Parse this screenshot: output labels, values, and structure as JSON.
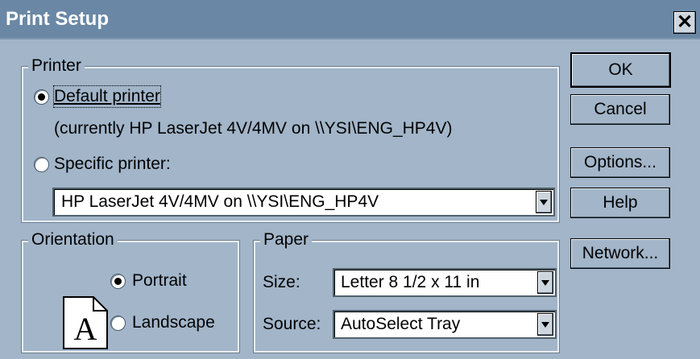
{
  "dialog": {
    "title": "Print Setup",
    "close_glyph": "✕"
  },
  "printer": {
    "legend": "Printer",
    "default_label": "Default printer",
    "default_selected": true,
    "current_info": "(currently HP LaserJet 4V/4MV on \\\\YSI\\ENG_HP4V)",
    "specific_label": "Specific printer:",
    "specific_selected": false,
    "specific_value": "HP LaserJet 4V/4MV on \\\\YSI\\ENG_HP4V"
  },
  "orientation": {
    "legend": "Orientation",
    "portrait_label": "Portrait",
    "portrait_selected": true,
    "landscape_label": "Landscape",
    "landscape_selected": false,
    "icon_letter": "A"
  },
  "paper": {
    "legend": "Paper",
    "size_label": "Size:",
    "size_value": "Letter 8 1/2 x 11 in",
    "source_label": "Source:",
    "source_value": "AutoSelect Tray"
  },
  "buttons": {
    "ok": "OK",
    "cancel": "Cancel",
    "options": "Options...",
    "help": "Help",
    "network": "Network..."
  }
}
